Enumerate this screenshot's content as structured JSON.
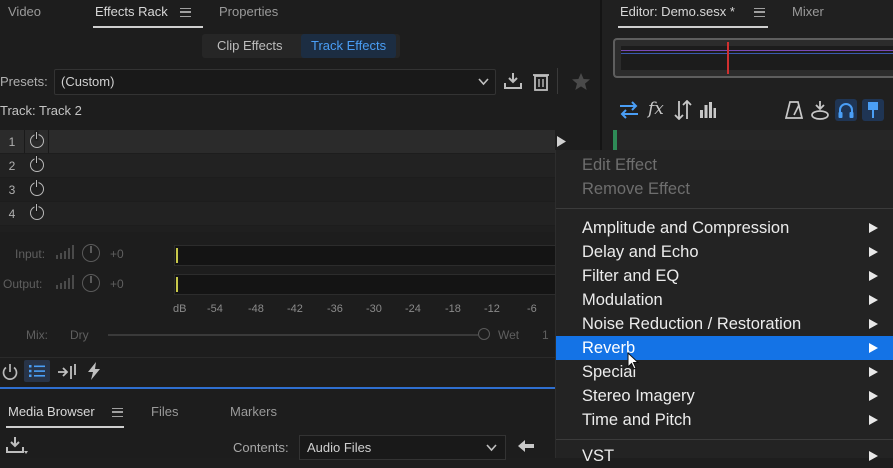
{
  "left_panel": {
    "tabs": [
      {
        "label": "Video"
      },
      {
        "label": "Effects Rack"
      },
      {
        "label": "Properties"
      }
    ],
    "subtabs": [
      {
        "label": "Clip Effects"
      },
      {
        "label": "Track Effects"
      }
    ],
    "presets": {
      "label": "Presets:",
      "value": "(Custom)"
    },
    "track_label": "Track: Track 2",
    "slots": [
      {
        "number": "1"
      },
      {
        "number": "2"
      },
      {
        "number": "3"
      },
      {
        "number": "4"
      }
    ],
    "input": {
      "label": "Input:",
      "value": "+0"
    },
    "output": {
      "label": "Output:",
      "value": "+0"
    },
    "scale": [
      "dB",
      "-54",
      "-48",
      "-42",
      "-36",
      "-30",
      "-24",
      "-18",
      "-12",
      "-6"
    ],
    "mix": {
      "label": "Mix:",
      "dry": "Dry",
      "wet": "Wet",
      "value": "1"
    }
  },
  "bottom_panel": {
    "tabs": [
      {
        "label": "Media Browser"
      },
      {
        "label": "Files"
      },
      {
        "label": "Markers"
      }
    ],
    "contents": {
      "label": "Contents:",
      "value": "Audio Files"
    }
  },
  "right_panel": {
    "tabs": [
      {
        "label": "Editor: Demo.sesx *"
      },
      {
        "label": "Mixer"
      }
    ],
    "toolbar_fx_label": "fx"
  },
  "context_menu": {
    "items": [
      {
        "label": "Edit Effect",
        "disabled": true
      },
      {
        "label": "Remove Effect",
        "disabled": true
      },
      {
        "label": "Amplitude and Compression"
      },
      {
        "label": "Delay and Echo"
      },
      {
        "label": "Filter and EQ"
      },
      {
        "label": "Modulation"
      },
      {
        "label": "Noise Reduction / Restoration"
      },
      {
        "label": "Reverb",
        "selected": true
      },
      {
        "label": "Special"
      },
      {
        "label": "Stereo Imagery"
      },
      {
        "label": "Time and Pitch"
      },
      {
        "label": "VST"
      }
    ]
  },
  "colors": {
    "accent": "#1473e6",
    "active_subtab_text": "#4a9ef5",
    "meter_peak": "#c8c84a",
    "playhead": "#d03030"
  }
}
